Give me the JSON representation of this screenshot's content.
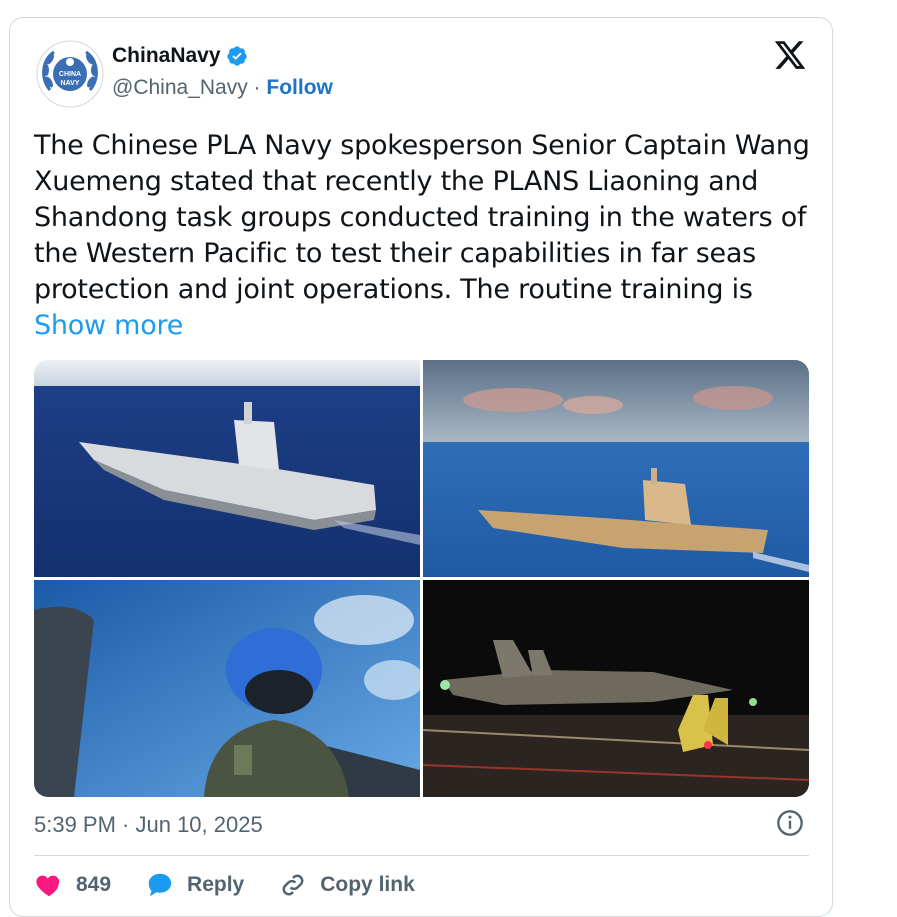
{
  "account": {
    "display_name": "ChinaNavy",
    "handle": "@China_Navy",
    "separator": " · ",
    "follow_label": "Follow",
    "avatar_text_top": "CHINA",
    "avatar_text_bottom": "NAVY"
  },
  "tweet": {
    "text": "The Chinese PLA Navy spokesperson Senior Captain Wang Xuemeng stated that recently the PLANS Liaoning and Shandong task groups conducted training in the waters of the Western Pacific to test their capabilities in far seas protection and joint operations. The routine training is ",
    "show_more_label": "Show more",
    "timestamp": "5:39 PM · Jun 10, 2025"
  },
  "media": [
    {
      "name": "carrier-photo-1"
    },
    {
      "name": "carrier-photo-2"
    },
    {
      "name": "pilot-cockpit-photo"
    },
    {
      "name": "night-deck-photo"
    }
  ],
  "actions": {
    "like_count": "849",
    "reply_label": "Reply",
    "copy_link_label": "Copy link"
  },
  "colors": {
    "accent": "#1d9bf0",
    "follow": "#1d74c8",
    "text": "#0f1419",
    "muted": "#536471",
    "like": "#f91880"
  }
}
